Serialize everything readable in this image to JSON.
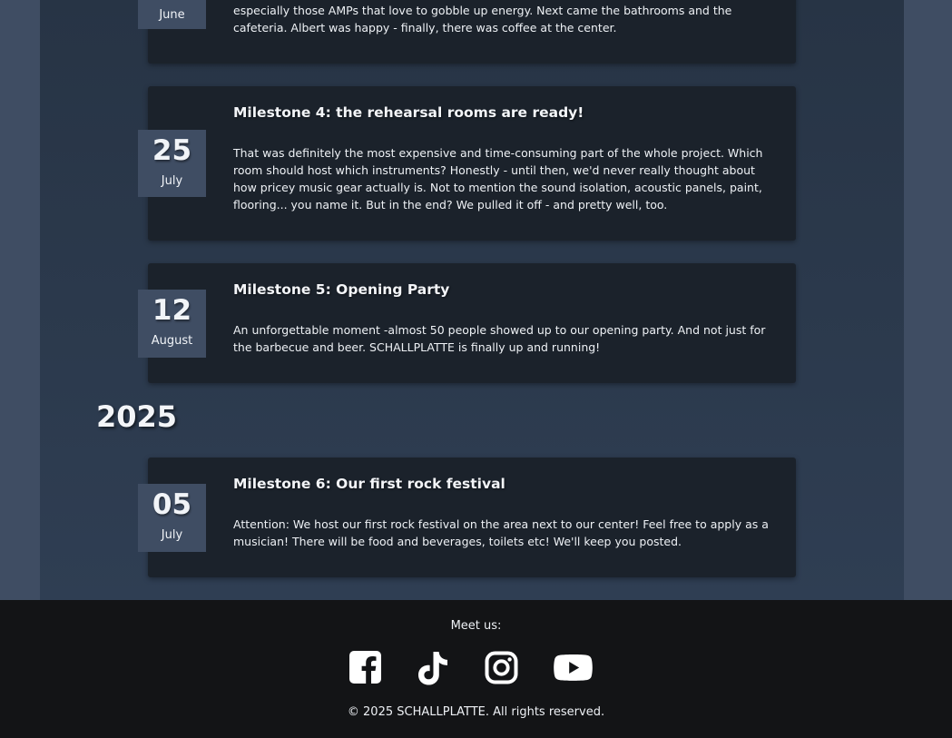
{
  "milestones": [
    {
      "day": "",
      "month": "June",
      "title": "",
      "text": "especially those AMPs that love to gobble up energy. Next came the bathrooms and the cafeteria. Albert was happy - finally, there was coffee at the center."
    },
    {
      "day": "25",
      "month": "July",
      "title": "Milestone 4: the rehearsal rooms are ready!",
      "text": "That was definitely the most expensive and time-consuming part of the whole project. Which room should host which instruments? Honestly - until then, we'd never really thought about how pricey music gear actually is. Not to mention the sound isolation, acoustic panels, paint, flooring... you name it. But in the end? We pulled it off - and pretty well, too."
    },
    {
      "day": "12",
      "month": "August",
      "title": "Milestone 5: Opening Party",
      "text": "An unforgettable moment -almost 50 people showed up to our opening party. And not just for the barbecue and beer. SCHALLPLATTE is finally up and running!"
    }
  ],
  "year_2025": {
    "heading": "2025",
    "milestones": [
      {
        "day": "05",
        "month": "July",
        "title": "Milestone 6: Our first rock festival",
        "text": "Attention: We host our first rock festival on the area next to our center! Feel free to apply as a musician! There will be food and beverages, toilets etc! We'll keep you posted."
      }
    ]
  },
  "footer": {
    "meet_us": "Meet us:",
    "social": [
      {
        "name": "facebook-icon"
      },
      {
        "name": "tiktok-icon"
      },
      {
        "name": "instagram-icon"
      },
      {
        "name": "youtube-icon"
      }
    ],
    "copyright": "© 2025 SCHALLPLATTE. All rights reserved."
  },
  "colors": {
    "page_background": "#3f4d63",
    "column_background": "#2b384a",
    "card_background": "#1b222b",
    "badge_background": "#3f4d63",
    "footer_background": "#131416",
    "text": "#eef1f5"
  }
}
